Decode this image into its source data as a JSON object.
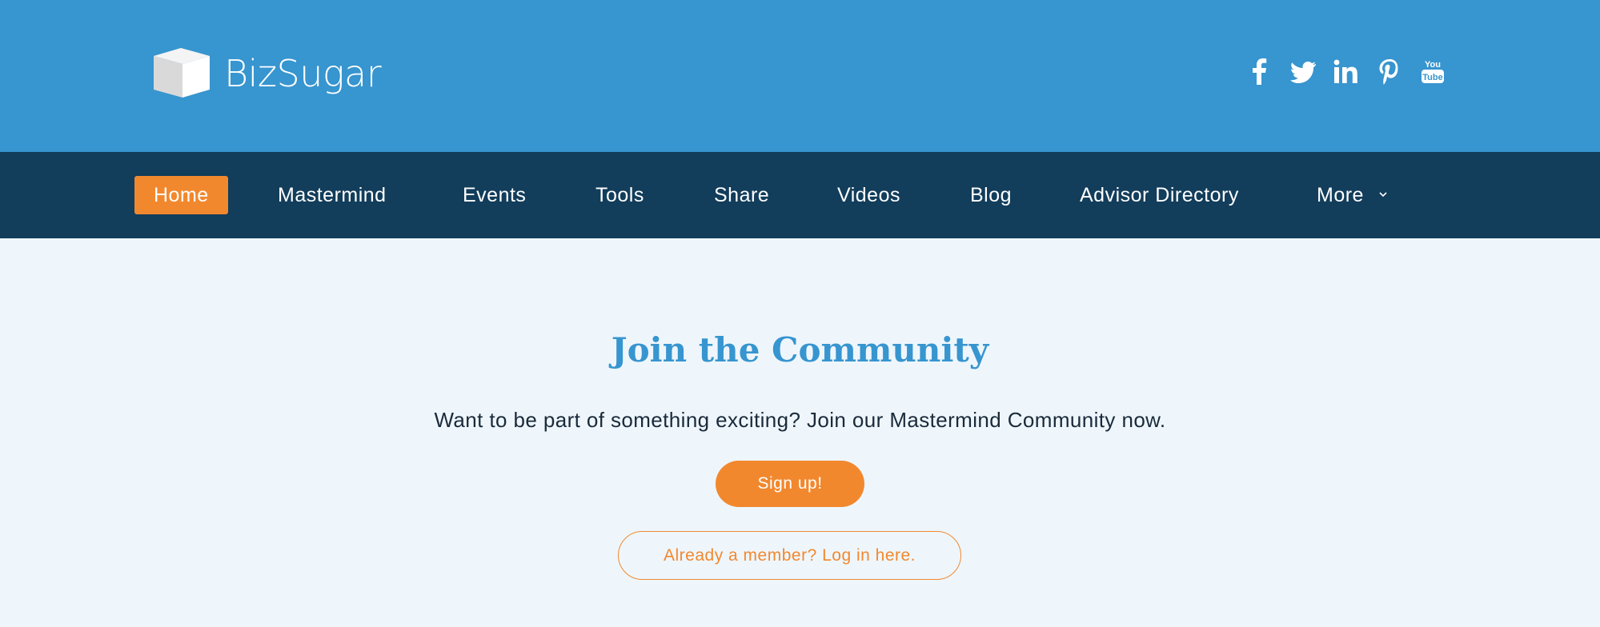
{
  "header": {
    "logo_text": "BizSugar",
    "social": [
      {
        "icon": "facebook-icon"
      },
      {
        "icon": "twitter-icon"
      },
      {
        "icon": "linkedin-icon"
      },
      {
        "icon": "pinterest-icon"
      },
      {
        "icon": "youtube-icon",
        "text_top": "You",
        "text_bottom": "Tube"
      }
    ]
  },
  "nav": {
    "items": [
      {
        "label": "Home",
        "active": true
      },
      {
        "label": "Mastermind"
      },
      {
        "label": "Events"
      },
      {
        "label": "Tools"
      },
      {
        "label": "Share"
      },
      {
        "label": "Videos"
      },
      {
        "label": "Blog"
      },
      {
        "label": "Advisor Directory"
      },
      {
        "label": "More"
      }
    ]
  },
  "main": {
    "title": "Join the Community",
    "subtitle": "Want to be part of something exciting? Join our Mastermind Community now.",
    "signup_label": "Sign up!",
    "login_label": "Already a member? Log in here."
  },
  "colors": {
    "header_bg": "#3795cf",
    "nav_bg": "#123d5b",
    "accent": "#f2882e",
    "page_bg": "#eef6fc",
    "title": "#3795cf"
  }
}
